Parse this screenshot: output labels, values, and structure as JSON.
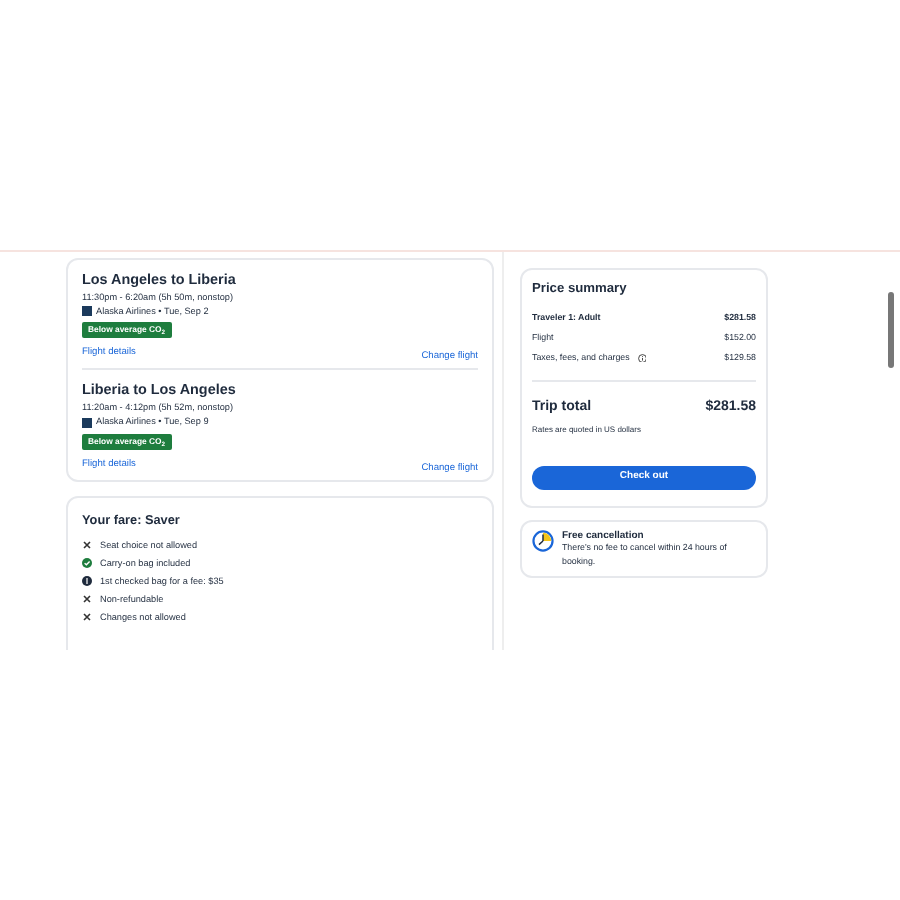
{
  "flights": [
    {
      "route": "Los Angeles to Liberia",
      "times": "11:30pm - 6:20am (5h 50m, nonstop)",
      "airline": "Alaska Airlines • Tue, Sep 2",
      "badge": "Below average CO$_{2}$",
      "details_link": "Flight details",
      "change_link": "Change flight"
    },
    {
      "route": "Liberia to Los Angeles",
      "times": "11:20am - 4:12pm (5h 52m, nonstop)",
      "airline": "Alaska Airlines • Tue, Sep 9",
      "badge": "Below average CO$_{2}$",
      "details_link": "Flight details",
      "change_link": "Change flight"
    }
  ],
  "fare": {
    "title": "Your fare: Saver",
    "items": [
      {
        "kind": "not_allowed",
        "text": "Seat choice not allowed"
      },
      {
        "kind": "included",
        "text": "Carry-on bag included"
      },
      {
        "kind": "fee",
        "text": "1st checked bag for a fee: $35"
      },
      {
        "kind": "not_allowed",
        "text": "Non-refundable"
      },
      {
        "kind": "not_allowed",
        "text": "Changes not allowed"
      }
    ]
  },
  "price_summary": {
    "title": "Price summary",
    "rows": [
      {
        "label": "Traveler 1: Adult",
        "amount": "$281.58",
        "bold": true,
        "info": false
      },
      {
        "label": "Flight",
        "amount": "$152.00",
        "bold": false,
        "info": false
      },
      {
        "label": "Taxes, fees, and charges",
        "amount": "$129.58",
        "bold": false,
        "info": true
      }
    ],
    "total_label": "Trip total",
    "total_amount": "$281.58",
    "note": "Rates are quoted in US dollars",
    "button": "Check out"
  },
  "cancellation": {
    "title": "Free cancellation",
    "text": "There's no fee to cancel within 24 hours of booking."
  }
}
